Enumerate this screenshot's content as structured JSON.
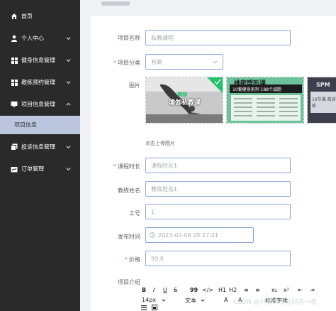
{
  "sidebar": {
    "items": [
      {
        "label": "首页",
        "icon": "home-icon",
        "expandable": false
      },
      {
        "label": "个人中心",
        "icon": "user-icon",
        "expandable": true
      },
      {
        "label": "健身信息管理",
        "icon": "grid-icon",
        "expandable": true
      },
      {
        "label": "教练预约管理",
        "icon": "grid-icon",
        "expandable": true
      },
      {
        "label": "项目信息管理",
        "icon": "monitor-icon",
        "expandable": true,
        "expanded": true
      },
      {
        "label": "投诉信息管理",
        "icon": "copy-icon",
        "expandable": true
      },
      {
        "label": "订单管理",
        "icon": "chart-icon",
        "expandable": true
      }
    ],
    "active_sub": "项目信息",
    "colors": {
      "bg": "#2a2a2a",
      "active_bg": "#bcc7df"
    }
  },
  "form": {
    "project_name": {
      "label": "项目名称",
      "value": "私教课程"
    },
    "category": {
      "label": "项目分类",
      "value": "有氧",
      "required": true
    },
    "image": {
      "label": "图片",
      "upload_hint": "点击上传图片"
    },
    "duration": {
      "label": "课程时长",
      "placeholder": "课程时长1",
      "required": true
    },
    "coach_name": {
      "label": "教练姓名",
      "placeholder": "教练姓名1"
    },
    "staff_id": {
      "label": "工号",
      "value": "1"
    },
    "publish_time": {
      "label": "发布时间",
      "value": "2023-02-08 20:27:21"
    },
    "price": {
      "label": "价格",
      "value": "99.9",
      "required": true
    },
    "intro": {
      "label": "项目介绍"
    }
  },
  "images": [
    {
      "overlay_top": "瑜伽",
      "overlay_main": "瑜伽私教课",
      "accent": "#23c26b"
    },
    {
      "title": "维密塑形课",
      "sub": "10套健身系列 188个减脂"
    },
    {
      "title": "SPM",
      "sub": "10节课 双训练"
    }
  ],
  "editor": {
    "row1": [
      "B",
      "I",
      "U",
      "S",
      "99",
      "</>",
      "H1",
      "H2",
      "≡",
      "≡",
      "x₂",
      "x²",
      "⇤",
      "⇥"
    ],
    "size": "14px",
    "text_label": "文本",
    "title_label": "标准字体"
  },
  "watermark": "CSDN @计算机专业码农一枚"
}
